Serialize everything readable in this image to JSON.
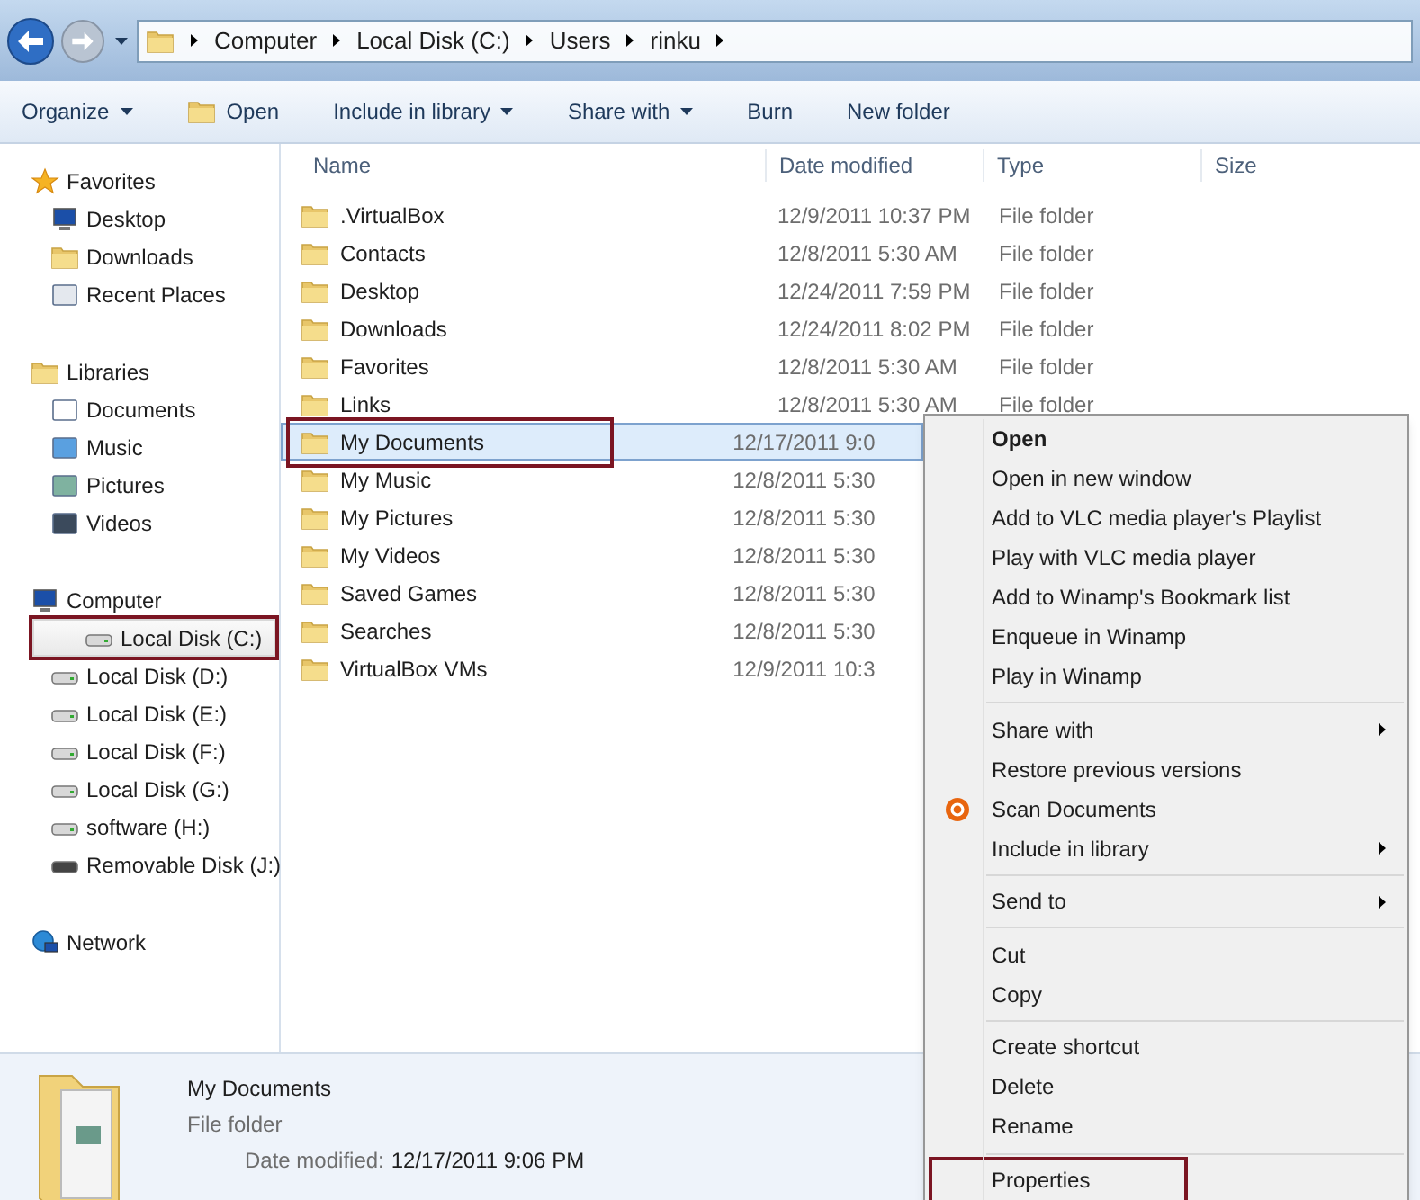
{
  "address_bar": {
    "crumbs": [
      "Computer",
      "Local Disk (C:)",
      "Users",
      "rinku"
    ]
  },
  "toolbar": [
    {
      "label": "Organize",
      "dropdown": true,
      "kind": "text"
    },
    {
      "label": "Open",
      "dropdown": false,
      "kind": "icon"
    },
    {
      "label": "Include in library",
      "dropdown": true,
      "kind": "text"
    },
    {
      "label": "Share with",
      "dropdown": true,
      "kind": "text"
    },
    {
      "label": "Burn",
      "dropdown": false,
      "kind": "text"
    },
    {
      "label": "New folder",
      "dropdown": false,
      "kind": "text"
    }
  ],
  "navigation": [
    {
      "label": "Favorites",
      "items": [
        {
          "label": "Desktop",
          "selected": false,
          "annotated": false
        },
        {
          "label": "Downloads",
          "selected": false,
          "annotated": false
        },
        {
          "label": "Recent Places",
          "selected": false,
          "annotated": false
        }
      ]
    },
    {
      "label": "Libraries",
      "items": [
        {
          "label": "Documents",
          "selected": false,
          "annotated": false
        },
        {
          "label": "Music",
          "selected": false,
          "annotated": false
        },
        {
          "label": "Pictures",
          "selected": false,
          "annotated": false
        },
        {
          "label": "Videos",
          "selected": false,
          "annotated": false
        }
      ]
    },
    {
      "label": "Computer",
      "items": [
        {
          "label": "Local Disk (C:)",
          "selected": true,
          "annotated": true
        },
        {
          "label": "Local Disk (D:)",
          "selected": false,
          "annotated": false
        },
        {
          "label": "Local Disk (E:)",
          "selected": false,
          "annotated": false
        },
        {
          "label": "Local Disk (F:)",
          "selected": false,
          "annotated": false
        },
        {
          "label": "Local Disk (G:)",
          "selected": false,
          "annotated": false
        },
        {
          "label": "software (H:)",
          "selected": false,
          "annotated": false
        },
        {
          "label": "Removable Disk (J:)",
          "selected": false,
          "annotated": false
        }
      ]
    },
    {
      "label": "Network"
    }
  ],
  "file_list": {
    "columns": [
      "Name",
      "Date modified",
      "Type",
      "Size"
    ],
    "rows": [
      {
        "name": ".VirtualBox",
        "date": "12/9/2011 10:37 PM",
        "type": "File folder",
        "selected": false,
        "annotated": false
      },
      {
        "name": "Contacts",
        "date": "12/8/2011 5:30 AM",
        "type": "File folder",
        "selected": false,
        "annotated": false
      },
      {
        "name": "Desktop",
        "date": "12/24/2011 7:59 PM",
        "type": "File folder",
        "selected": false,
        "annotated": false
      },
      {
        "name": "Downloads",
        "date": "12/24/2011 8:02 PM",
        "type": "File folder",
        "selected": false,
        "annotated": false
      },
      {
        "name": "Favorites",
        "date": "12/8/2011 5:30 AM",
        "type": "File folder",
        "selected": false,
        "annotated": false
      },
      {
        "name": "Links",
        "date": "12/8/2011 5:30 AM",
        "type": "File folder",
        "selected": false,
        "annotated": false
      },
      {
        "name": "My Documents",
        "date": "12/17/2011 9:0",
        "selected": true,
        "annotated": true
      },
      {
        "name": "My Music",
        "date": "12/8/2011 5:30",
        "selected": false,
        "annotated": false
      },
      {
        "name": "My Pictures",
        "date": "12/8/2011 5:30",
        "selected": false,
        "annotated": false
      },
      {
        "name": "My Videos",
        "date": "12/8/2011 5:30",
        "selected": false,
        "annotated": false
      },
      {
        "name": "Saved Games",
        "date": "12/8/2011 5:30",
        "selected": false,
        "annotated": false
      },
      {
        "name": "Searches",
        "date": "12/8/2011 5:30",
        "selected": false,
        "annotated": false
      },
      {
        "name": "VirtualBox VMs",
        "date": "12/9/2011 10:3",
        "selected": false,
        "annotated": false
      }
    ]
  },
  "context_menu": [
    {
      "kind": "item",
      "label": "Open",
      "default": true,
      "submenu": false,
      "icon": false,
      "annotated": false
    },
    {
      "kind": "item",
      "label": "Open in new window",
      "default": false,
      "submenu": false,
      "icon": false,
      "annotated": false
    },
    {
      "kind": "item",
      "label": "Add to VLC media player's Playlist",
      "default": false,
      "submenu": false,
      "icon": false,
      "annotated": false
    },
    {
      "kind": "item",
      "label": "Play with VLC media player",
      "default": false,
      "submenu": false,
      "icon": false,
      "annotated": false
    },
    {
      "kind": "item",
      "label": "Add to Winamp's Bookmark list",
      "default": false,
      "submenu": false,
      "icon": false,
      "annotated": false
    },
    {
      "kind": "item",
      "label": "Enqueue in Winamp",
      "default": false,
      "submenu": false,
      "icon": false,
      "annotated": false
    },
    {
      "kind": "item",
      "label": "Play in Winamp",
      "default": false,
      "submenu": false,
      "icon": false,
      "annotated": false
    },
    {
      "kind": "separator"
    },
    {
      "kind": "item",
      "label": "Share with",
      "default": false,
      "submenu": true,
      "icon": false,
      "annotated": false
    },
    {
      "kind": "item",
      "label": "Restore previous versions",
      "default": false,
      "submenu": false,
      "icon": false,
      "annotated": false
    },
    {
      "kind": "item",
      "label": "Scan Documents",
      "default": false,
      "submenu": false,
      "icon": true,
      "annotated": false
    },
    {
      "kind": "item",
      "label": "Include in library",
      "default": false,
      "submenu": true,
      "icon": false,
      "annotated": false
    },
    {
      "kind": "separator"
    },
    {
      "kind": "item",
      "label": "Send to",
      "default": false,
      "submenu": true,
      "icon": false,
      "annotated": false
    },
    {
      "kind": "separator"
    },
    {
      "kind": "item",
      "label": "Cut",
      "default": false,
      "submenu": false,
      "icon": false,
      "annotated": false
    },
    {
      "kind": "item",
      "label": "Copy",
      "default": false,
      "submenu": false,
      "icon": false,
      "annotated": false
    },
    {
      "kind": "separator"
    },
    {
      "kind": "item",
      "label": "Create shortcut",
      "default": false,
      "submenu": false,
      "icon": false,
      "annotated": false
    },
    {
      "kind": "item",
      "label": "Delete",
      "default": false,
      "submenu": false,
      "icon": false,
      "annotated": false
    },
    {
      "kind": "item",
      "label": "Rename",
      "default": false,
      "submenu": false,
      "icon": false,
      "annotated": false
    },
    {
      "kind": "separator"
    },
    {
      "kind": "item",
      "label": "Properties",
      "default": false,
      "submenu": false,
      "icon": false,
      "annotated": true
    }
  ],
  "details_pane": {
    "name": "My Documents",
    "type": "File folder",
    "date_label": "Date modified:",
    "date_value": "12/17/2011 9:06 PM"
  }
}
